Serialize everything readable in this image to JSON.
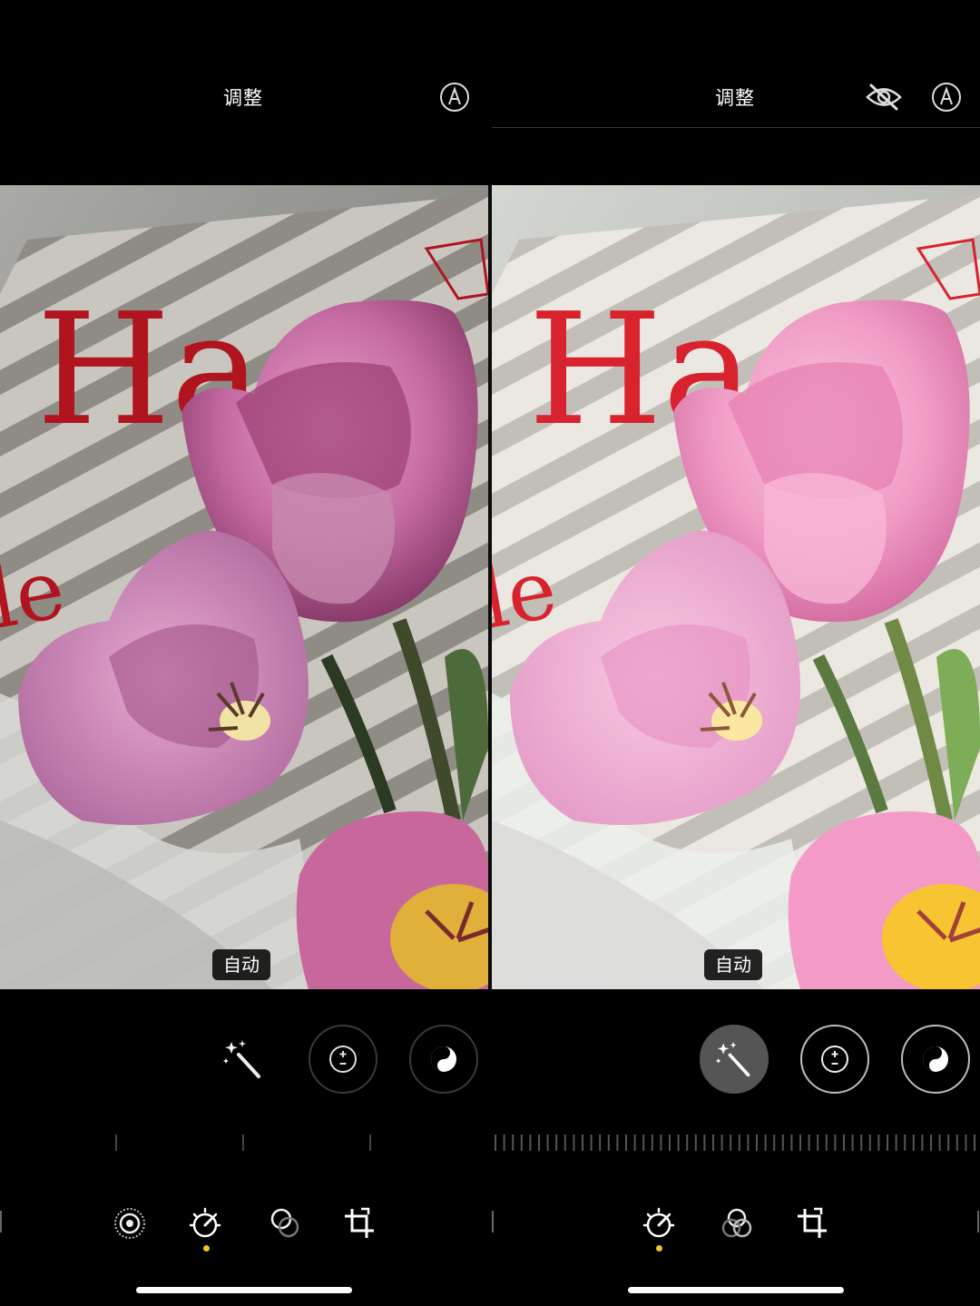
{
  "left": {
    "title": "调整",
    "auto_label": "自动",
    "hidden_icon": "",
    "markup_icon": "markup-icon"
  },
  "right": {
    "title": "调整",
    "auto_label": "自动",
    "visibility_icon": "eye-slash-icon",
    "markup_icon": "markup-icon"
  },
  "tools": [
    "magic-wand-icon",
    "exposure-icon",
    "brilliance-icon"
  ],
  "tabbar": [
    "live-photo-icon",
    "adjust-icon",
    "filters-icon",
    "crop-icon"
  ],
  "colors": {
    "accent_dot": "#f3c32b",
    "active_tool_bg": "#555555",
    "text": "#ffffff"
  }
}
